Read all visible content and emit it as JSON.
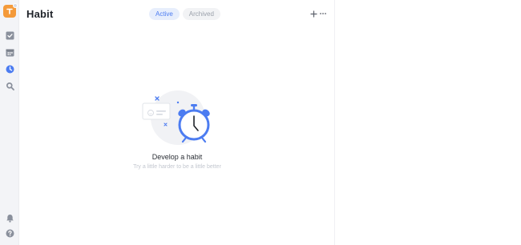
{
  "app": {
    "accent_color": "#f49a3a",
    "primary_color": "#4c7cf1"
  },
  "sidebar": {
    "items": [
      {
        "icon": "check-square-icon"
      },
      {
        "icon": "calendar-icon"
      },
      {
        "icon": "habit-icon",
        "active": true
      },
      {
        "icon": "search-icon"
      }
    ],
    "bottom_items": [
      {
        "icon": "bell-icon"
      },
      {
        "icon": "help-icon"
      }
    ]
  },
  "header": {
    "title": "Habit",
    "tabs": [
      {
        "label": "Active",
        "selected": true
      },
      {
        "label": "Archived",
        "selected": false
      }
    ],
    "add_icon": "plus-icon",
    "more_icon": "more-icon"
  },
  "empty_state": {
    "title": "Develop a habit",
    "subtitle": "Try a little harder to be a little better",
    "illustration_icon": "alarm-clock-icon"
  }
}
